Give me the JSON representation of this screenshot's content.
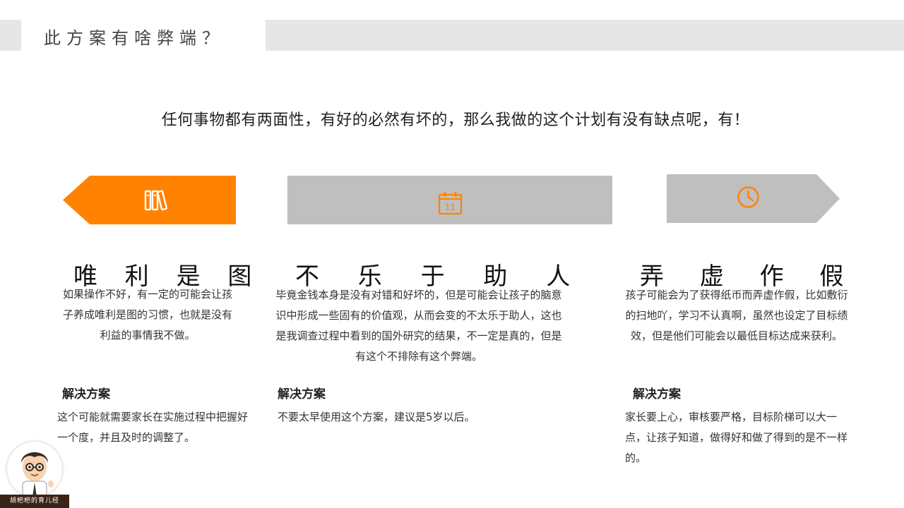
{
  "header": {
    "title": "此方案有啥弊端？"
  },
  "intro": {
    "text": "任何事物都有两面性，有好的必然有坏的，那么我做的这个计划有没有缺点呢，有！"
  },
  "colors": {
    "accent": "#ff8200",
    "gray_banner": "#bfbfbf",
    "title_bar": "#e6e6e6"
  },
  "columns": [
    {
      "icon": "books-icon",
      "heading": "唯 利 是 图",
      "description": "如果操作不好，有一定的可能会让孩子养成唯利是图的习惯，也就是没有利益的事情我不做。",
      "solution_label": "解决方案",
      "solution_text": "这个可能就需要家长在实施过程中把握好一个度，并且及时的调整了。"
    },
    {
      "icon": "calendar-icon",
      "calendar_day": "11",
      "heading": "不 乐 于 助 人",
      "description": "毕竟金钱本身是没有对错和好坏的，但是可能会让孩子的脑意识中形成一些固有的价值观，从而会变的不太乐于助人，这也是我调查过程中看到的国外研究的结果，不一定是真的，但是有这个不排除有这个弊端。",
      "solution_label": "解决方案",
      "solution_text": "不要太早使用这个方案，建议是5岁以后。"
    },
    {
      "icon": "clock-icon",
      "heading": "弄 虚 作 假",
      "description": "孩子可能会为了获得纸币而弄虚作假，比如敷衍的扫地吖，学习不认真啊，虽然也设定了目标绩效，但是他们可能会以最低目标达成来获利。",
      "solution_label": "解决方案",
      "solution_text": "家长要上心，审核要严格，目标阶梯可以大一点，让孩子知道，做得好和做了得到的是不一样的。"
    }
  ],
  "brand": {
    "text": "胡杷杷的育儿经"
  }
}
